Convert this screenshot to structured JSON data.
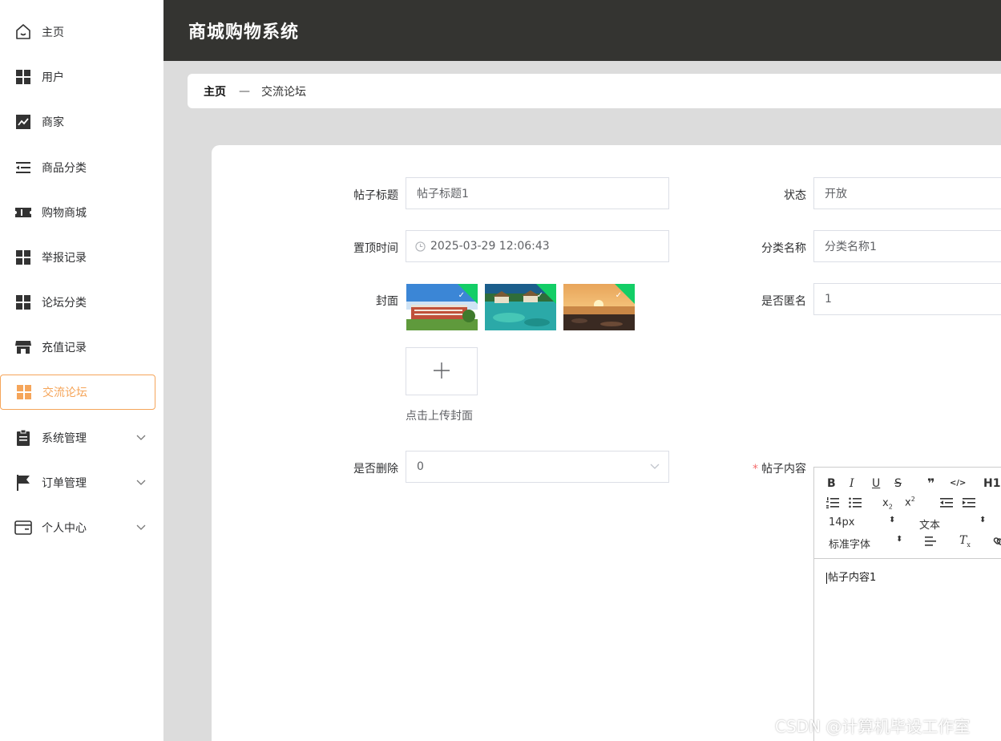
{
  "sidebar": {
    "items": [
      {
        "label": "主页",
        "icon": "home-icon"
      },
      {
        "label": "用户",
        "icon": "grid-icon"
      },
      {
        "label": "商家",
        "icon": "chart-icon"
      },
      {
        "label": "商品分类",
        "icon": "list-indent-icon"
      },
      {
        "label": "购物商城",
        "icon": "ticket-icon"
      },
      {
        "label": "举报记录",
        "icon": "grid-icon"
      },
      {
        "label": "论坛分类",
        "icon": "grid-icon"
      },
      {
        "label": "充值记录",
        "icon": "store-icon"
      },
      {
        "label": "交流论坛",
        "icon": "grid-icon",
        "active": true
      },
      {
        "label": "系统管理",
        "icon": "clipboard-icon",
        "expandable": true
      },
      {
        "label": "订单管理",
        "icon": "flag-icon",
        "expandable": true
      },
      {
        "label": "个人中心",
        "icon": "wallet-icon",
        "expandable": true
      }
    ]
  },
  "header": {
    "title": "商城购物系统"
  },
  "breadcrumb": {
    "home": "主页",
    "separator": "—",
    "current": "交流论坛"
  },
  "form": {
    "post_title": {
      "label": "帖子标题",
      "value": "帖子标题1"
    },
    "status": {
      "label": "状态",
      "value": "开放"
    },
    "pin_time": {
      "label": "置顶时间",
      "value": "2025-03-29 12:06:43"
    },
    "category": {
      "label": "分类名称",
      "value": "分类名称1"
    },
    "cover": {
      "label": "封面",
      "upload_tip": "点击上传封面",
      "upload_icon": "plus-icon",
      "images": [
        "campus-building",
        "tropical-lagoon",
        "sunset-beach"
      ]
    },
    "anonymous": {
      "label": "是否匿名",
      "value": "1"
    },
    "deleted": {
      "label": "是否删除",
      "value": "0"
    },
    "content": {
      "label": "帖子内容",
      "required_mark": "*",
      "value": "帖子内容1"
    }
  },
  "editor": {
    "toolbar_row1": [
      "B",
      "I",
      "U",
      "S",
      "❞",
      "</>",
      "H1"
    ],
    "font_size": "14px",
    "paragraph": "文本",
    "font_family": "标准字体"
  },
  "watermark": "CSDN @计算机毕设工作室",
  "colors": {
    "accent": "#f5a55a",
    "header_bg": "#343431",
    "upload_success": "#13ce66"
  }
}
